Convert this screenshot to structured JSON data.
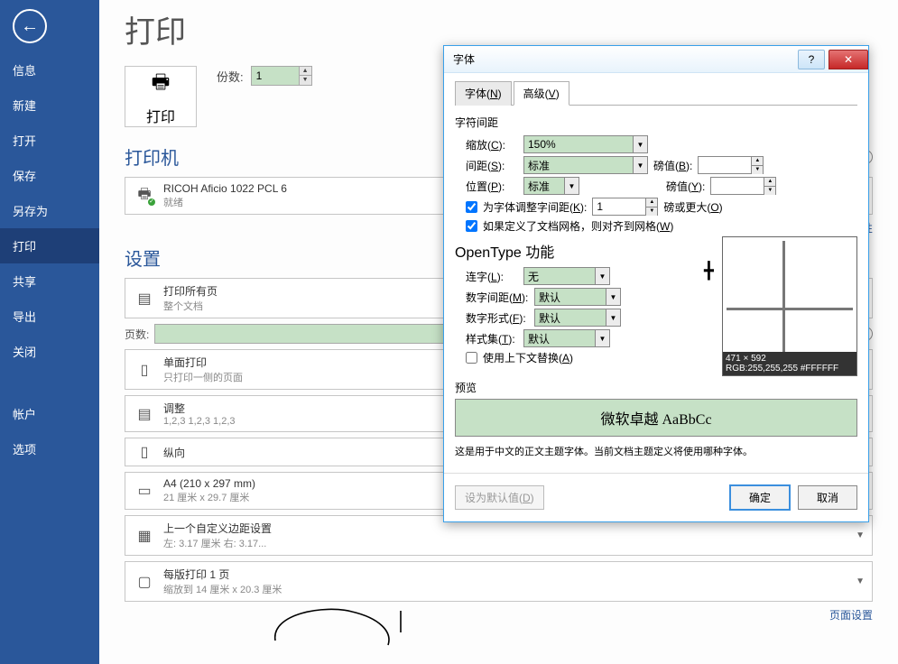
{
  "sidebar": {
    "items": [
      "信息",
      "新建",
      "打开",
      "保存",
      "另存为",
      "打印",
      "共享",
      "导出",
      "关闭"
    ],
    "bottom": [
      "帐户",
      "选项"
    ]
  },
  "print": {
    "title": "打印",
    "printLabel": "打印",
    "copiesLabel": "份数:",
    "copiesValue": "1",
    "printerHeader": "打印机",
    "printerName": "RICOH Aficio 1022 PCL 6",
    "printerStatus": "就绪",
    "printerProps": "打印机属性",
    "settingsHeader": "设置",
    "printAll": {
      "t1": "打印所有页",
      "t2": "整个文档"
    },
    "pagesLabel": "页数:",
    "oneSide": {
      "t1": "单面打印",
      "t2": "只打印一侧的页面"
    },
    "collate": {
      "t1": "调整",
      "t2": "1,2,3    1,2,3    1,2,3"
    },
    "orient": {
      "t1": "纵向",
      "t2": ""
    },
    "paper": {
      "t1": "A4 (210 x 297 mm)",
      "t2": "21 厘米 x 29.7 厘米"
    },
    "margins": {
      "t1": "上一个自定义边距设置",
      "t2": "左:  3.17 厘米   右:  3.17..."
    },
    "perSheet": {
      "t1": "每版打印 1 页",
      "t2": "缩放到 14 厘米 x 20.3 厘米"
    },
    "pageSetup": "页面设置"
  },
  "dialog": {
    "title": "字体",
    "tabFont": "字体(N)",
    "tabAdvanced": "高级(V)",
    "spacingGroup": "字符间距",
    "scaleLabel": "缩放(C):",
    "scaleValue": "150%",
    "spacingLabel": "间距(S):",
    "spacingValue": "标准",
    "pointB": "磅值(B):",
    "posLabel": "位置(P):",
    "posValue": "标准",
    "pointY": "磅值(Y):",
    "kernLabel": "为字体调整字间距(K):",
    "kernValue": "1",
    "kernUnit": "磅或更大(O)",
    "snapGrid": "如果定义了文档网格，则对齐到网格(W)",
    "otTitle": "OpenType 功能",
    "ligLabel": "连字(L):",
    "ligValue": "无",
    "numSpLabel": "数字间距(M):",
    "numSpValue": "默认",
    "numFormLabel": "数字形式(F):",
    "numFormValue": "默认",
    "styleSetLabel": "样式集(T):",
    "styleSetValue": "默认",
    "contextAlt": "使用上下文替换(A)",
    "coord1": "471 × 592",
    "coord2": "RGB:255,255,255 #FFFFFF",
    "previewLabel": "预览",
    "previewText": "微软卓越 AaBbCc",
    "previewDesc": "这是用于中文的正文主题字体。当前文档主题定义将使用哪种字体。",
    "setDefault": "设为默认值(D)",
    "ok": "确定",
    "cancel": "取消"
  }
}
